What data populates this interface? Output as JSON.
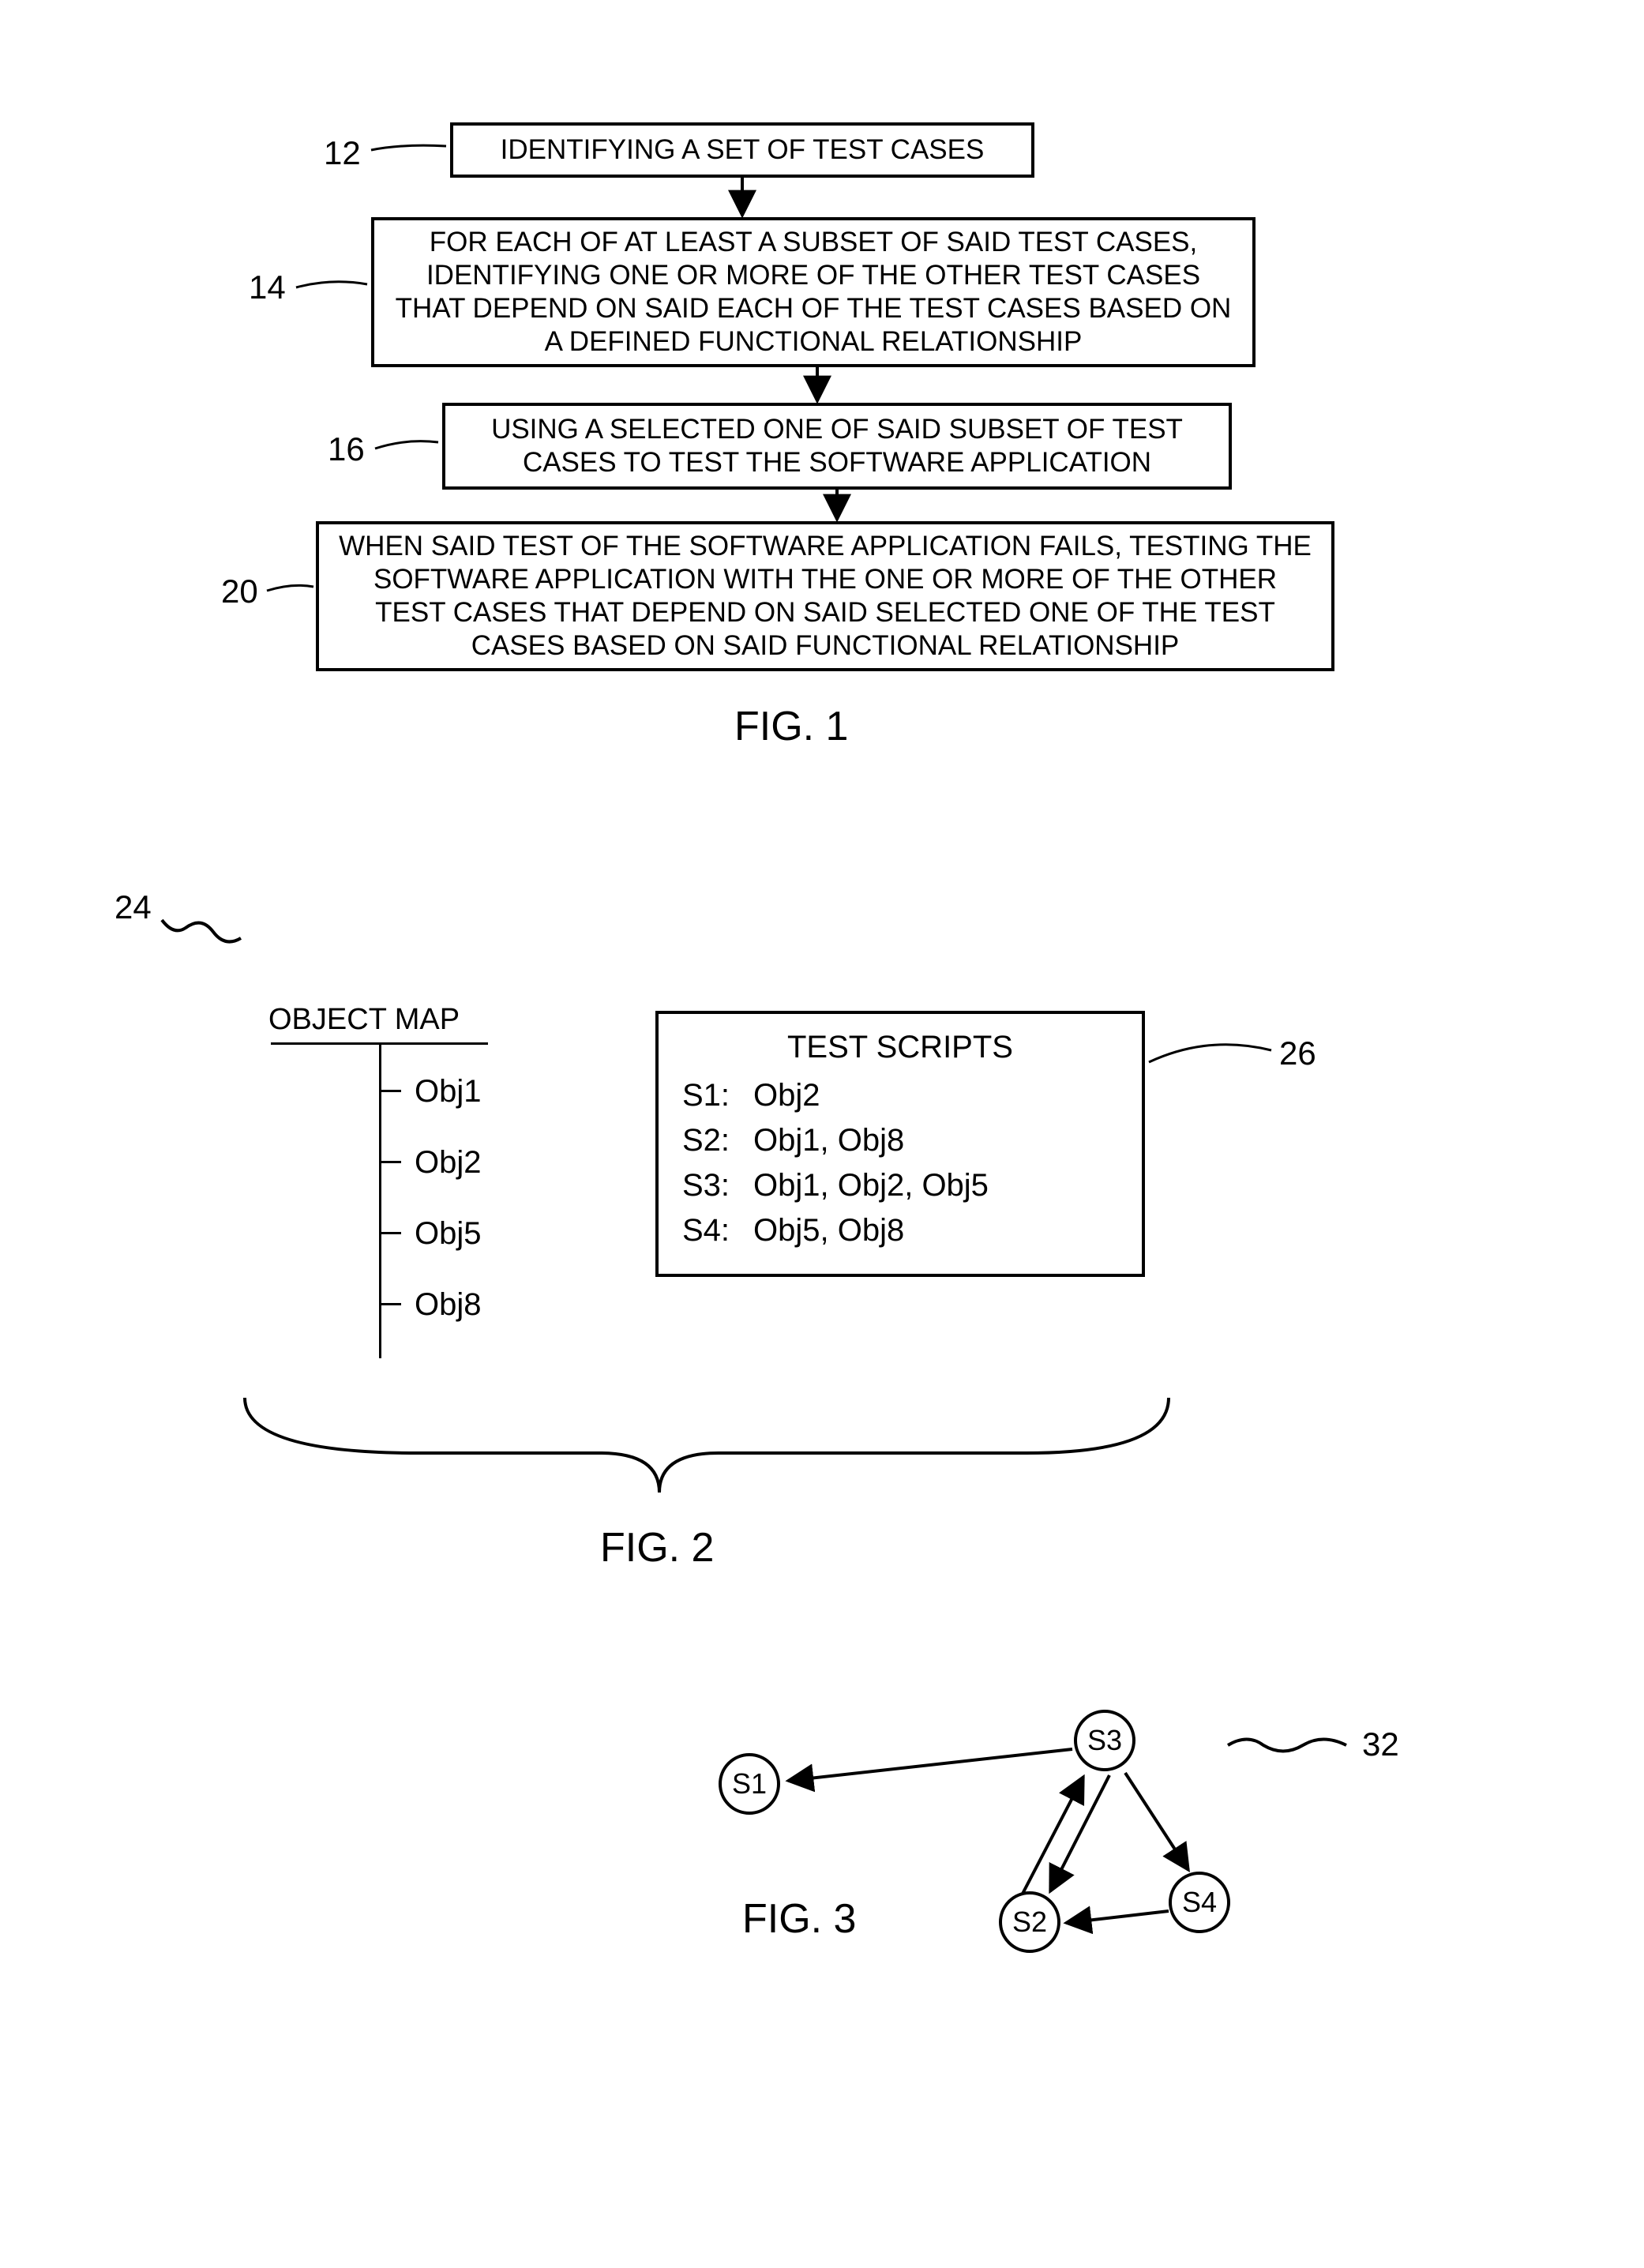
{
  "fig1": {
    "labels": {
      "s12": "12",
      "s14": "14",
      "s16": "16",
      "s20": "20"
    },
    "steps": {
      "s12": "IDENTIFYING A SET OF TEST CASES",
      "s14": "FOR EACH OF AT LEAST A SUBSET OF SAID TEST CASES, IDENTIFYING ONE OR MORE OF THE OTHER TEST CASES THAT DEPEND ON SAID EACH OF THE TEST CASES BASED ON A DEFINED FUNCTIONAL RELATIONSHIP",
      "s16": "USING A SELECTED ONE OF SAID SUBSET OF TEST CASES TO TEST THE SOFTWARE APPLICATION",
      "s20": "WHEN SAID TEST OF THE SOFTWARE APPLICATION FAILS, TESTING THE SOFTWARE APPLICATION WITH THE ONE OR MORE OF THE OTHER TEST CASES THAT DEPEND ON SAID SELECTED ONE OF THE TEST CASES BASED ON SAID FUNCTIONAL RELATIONSHIP"
    },
    "caption": "FIG. 1"
  },
  "fig2": {
    "labels": {
      "l24": "24",
      "l26": "26"
    },
    "object_map": {
      "title": "OBJECT MAP",
      "items": [
        "Obj1",
        "Obj2",
        "Obj5",
        "Obj8"
      ]
    },
    "scripts": {
      "title": "TEST SCRIPTS",
      "rows": [
        {
          "key": "S1:",
          "val": "Obj2"
        },
        {
          "key": "S2:",
          "val": "Obj1, Obj8"
        },
        {
          "key": "S3:",
          "val": "Obj1, Obj2, Obj5"
        },
        {
          "key": "S4:",
          "val": "Obj5, Obj8"
        }
      ]
    },
    "caption": "FIG. 2"
  },
  "fig3": {
    "labels": {
      "l32": "32"
    },
    "nodes": {
      "n1": "S1",
      "n2": "S2",
      "n3": "S3",
      "n4": "S4"
    },
    "caption": "FIG. 3"
  },
  "chart_data": [
    {
      "type": "flowchart",
      "title": "FIG. 1",
      "nodes": [
        {
          "id": "12",
          "text": "IDENTIFYING A SET OF TEST CASES"
        },
        {
          "id": "14",
          "text": "FOR EACH OF AT LEAST A SUBSET OF SAID TEST CASES, IDENTIFYING ONE OR MORE OF THE OTHER TEST CASES THAT DEPEND ON SAID EACH OF THE TEST CASES BASED ON A DEFINED FUNCTIONAL RELATIONSHIP"
        },
        {
          "id": "16",
          "text": "USING A SELECTED ONE OF SAID SUBSET OF TEST CASES TO TEST THE SOFTWARE APPLICATION"
        },
        {
          "id": "20",
          "text": "WHEN SAID TEST OF THE SOFTWARE APPLICATION FAILS, TESTING THE SOFTWARE APPLICATION WITH THE ONE OR MORE OF THE OTHER TEST CASES THAT DEPEND ON SAID SELECTED ONE OF THE TEST CASES BASED ON SAID FUNCTIONAL RELATIONSHIP"
        }
      ],
      "edges": [
        {
          "from": "12",
          "to": "14"
        },
        {
          "from": "14",
          "to": "16"
        },
        {
          "from": "16",
          "to": "20"
        }
      ]
    },
    {
      "type": "mapping",
      "title": "FIG. 2",
      "ref_left": "24",
      "ref_right": "26",
      "object_map": [
        "Obj1",
        "Obj2",
        "Obj5",
        "Obj8"
      ],
      "test_scripts": {
        "S1": [
          "Obj2"
        ],
        "S2": [
          "Obj1",
          "Obj8"
        ],
        "S3": [
          "Obj1",
          "Obj2",
          "Obj5"
        ],
        "S4": [
          "Obj5",
          "Obj8"
        ]
      }
    },
    {
      "type": "graph",
      "title": "FIG. 3",
      "ref": "32",
      "nodes": [
        "S1",
        "S2",
        "S3",
        "S4"
      ],
      "edges": [
        {
          "from": "S3",
          "to": "S1"
        },
        {
          "from": "S3",
          "to": "S2"
        },
        {
          "from": "S3",
          "to": "S4"
        },
        {
          "from": "S2",
          "to": "S3"
        },
        {
          "from": "S4",
          "to": "S2"
        }
      ]
    }
  ]
}
